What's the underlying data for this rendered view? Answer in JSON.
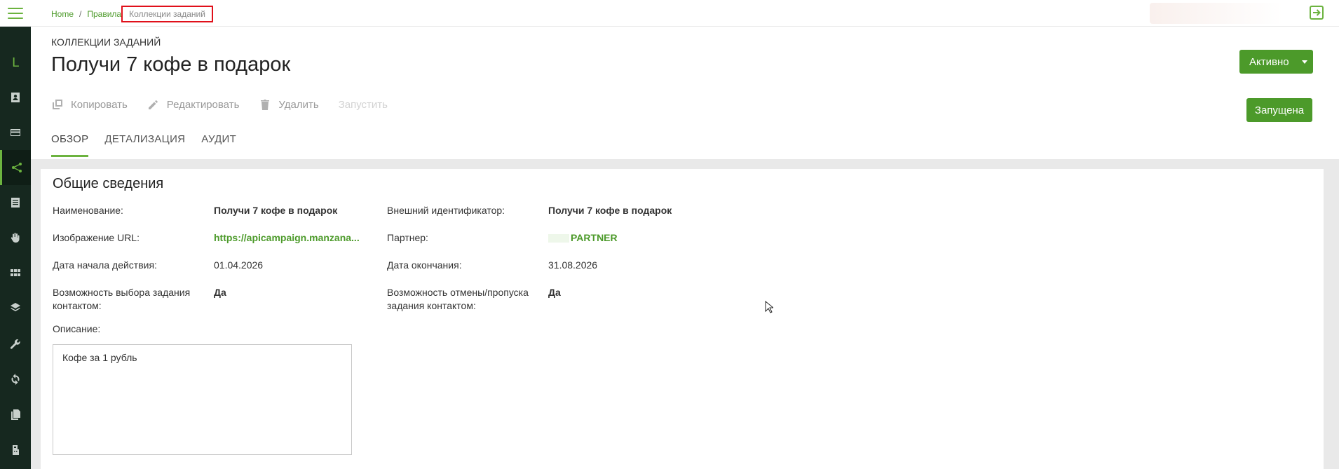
{
  "breadcrumb": {
    "home": "Home",
    "rules": "Правила",
    "current": "Коллекции заданий"
  },
  "sidebar": {
    "logo": "L",
    "items": [
      {
        "icon": "contact-card-icon"
      },
      {
        "icon": "credit-card-icon"
      },
      {
        "icon": "share-icon",
        "active": true
      },
      {
        "icon": "list-icon"
      },
      {
        "icon": "hand-icon"
      },
      {
        "icon": "apps-grid-icon"
      },
      {
        "icon": "layers-icon"
      },
      {
        "icon": "wrench-icon"
      },
      {
        "icon": "sync-icon"
      },
      {
        "icon": "copy-icon"
      },
      {
        "icon": "pos-terminal-icon"
      }
    ]
  },
  "header": {
    "section": "КОЛЛЕКЦИИ ЗАДАНИЙ",
    "title": "Получи 7 кофе в подарок",
    "status_button": "Активно",
    "launched_button": "Запущена"
  },
  "toolbar": {
    "copy": "Копировать",
    "edit": "Редактировать",
    "delete": "Удалить",
    "run": "Запустить"
  },
  "tabs": [
    "ОБЗОР",
    "ДЕТАЛИЗАЦИЯ",
    "АУДИТ"
  ],
  "overview": {
    "title": "Общие сведения",
    "name_label": "Наименование:",
    "name_value": "Получи 7 кофе в подарок",
    "external_id_label": "Внешний идентификатор:",
    "external_id_value": "Получи 7 кофе в подарок",
    "image_url_label": "Изображение URL:",
    "image_url_value": "https://apicampaign.manzana...",
    "partner_label": "Партнер:",
    "partner_value": "PARTNER",
    "start_date_label": "Дата начала действия:",
    "start_date_value": "01.04.2026",
    "end_date_label": "Дата окончания:",
    "end_date_value": "31.08.2026",
    "choice_label_1": "Возможность выбора задания",
    "choice_label_2": "контактом:",
    "choice_value": "Да",
    "cancel_label_1": "Возможность отмены/пропуска",
    "cancel_label_2": "задания контактом:",
    "cancel_value": "Да",
    "description_label": "Описание:",
    "description_value": "Кофе за 1 рубль"
  },
  "colors": {
    "accent": "#6cb33f",
    "button": "#4c9a2a",
    "sidebar": "#16281f",
    "highlight": "#e0101a"
  }
}
